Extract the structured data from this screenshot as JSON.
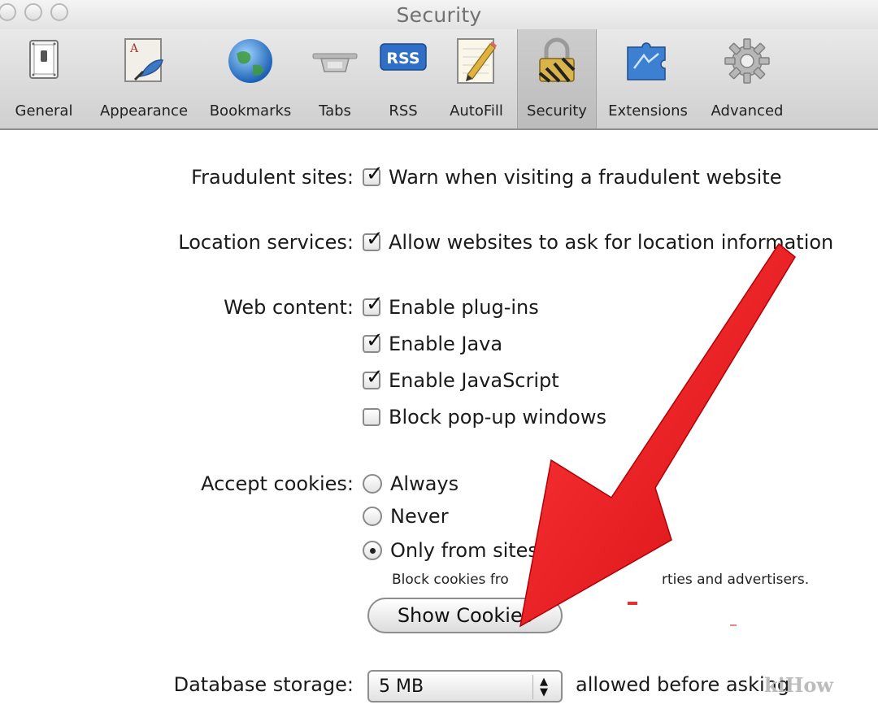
{
  "window": {
    "title": "Security"
  },
  "toolbar": {
    "items": [
      {
        "label": "General",
        "icon": "general-switch-icon"
      },
      {
        "label": "Appearance",
        "icon": "appearance-icon"
      },
      {
        "label": "Bookmarks",
        "icon": "globe-icon"
      },
      {
        "label": "Tabs",
        "icon": "tabs-icon"
      },
      {
        "label": "RSS",
        "icon": "rss-icon",
        "icon_text": "RSS"
      },
      {
        "label": "AutoFill",
        "icon": "autofill-pencil-icon"
      },
      {
        "label": "Security",
        "icon": "padlock-icon",
        "selected": true
      },
      {
        "label": "Extensions",
        "icon": "puzzle-icon"
      },
      {
        "label": "Advanced",
        "icon": "gear-icon"
      }
    ]
  },
  "security": {
    "fraudulent": {
      "label": "Fraudulent sites:",
      "option": {
        "text": "Warn when visiting a fraudulent website",
        "checked": true
      }
    },
    "location": {
      "label": "Location services:",
      "option": {
        "text": "Allow websites to ask for location information",
        "checked": true
      }
    },
    "web_content": {
      "label": "Web content:",
      "options": [
        {
          "text": "Enable plug-ins",
          "checked": true
        },
        {
          "text": "Enable Java",
          "checked": true
        },
        {
          "text": "Enable JavaScript",
          "checked": true
        },
        {
          "text": "Block pop-up windows",
          "checked": false
        }
      ]
    },
    "cookies": {
      "label": "Accept cookies:",
      "options": [
        {
          "text": "Always",
          "selected": false
        },
        {
          "text": "Never",
          "selected": false
        },
        {
          "text": "Only from sites",
          "selected": true
        }
      ],
      "note_left": "Block cookies fro",
      "note_right": "rties and advertisers.",
      "show_button": "Show Cookies"
    },
    "database": {
      "label": "Database storage:",
      "value": "5 MB",
      "after": "allowed before asking"
    }
  },
  "watermark": "kiHow",
  "colors": {
    "arrow": "#e8141a",
    "toolbar_bg": "#dcdcdc",
    "window_bg": "#ffffff"
  }
}
